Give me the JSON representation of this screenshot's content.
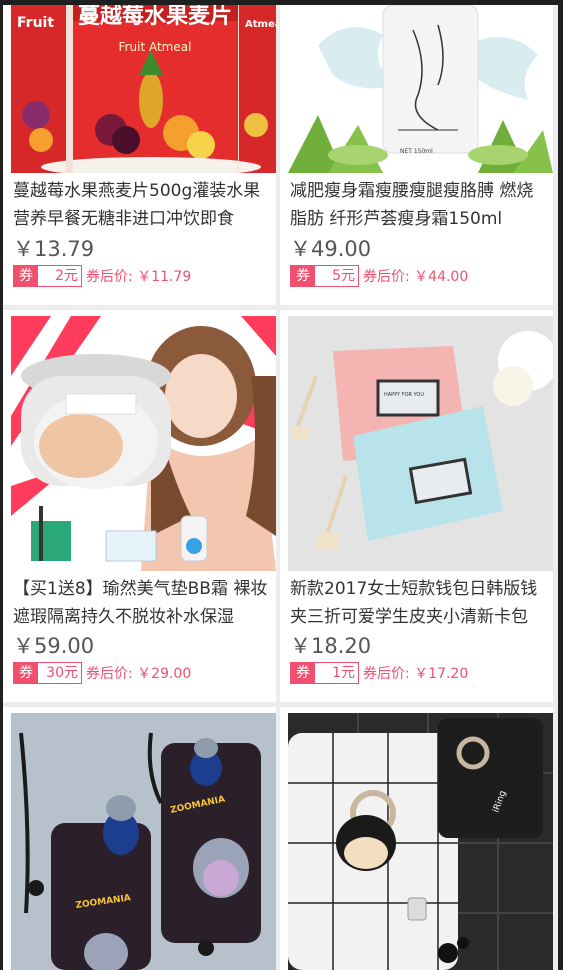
{
  "products": [
    {
      "title": "蔓越莓水果燕麦片500g灌装水果营养早餐无糖非进口冲饮即食",
      "price": "￥13.79",
      "coupon_label": "券",
      "coupon_amount": "2元",
      "after_price": "券后价: ￥11.79",
      "image_alt": "oatmeal-cans-image",
      "image_text_1": "蔓越莓水果麦片",
      "image_text_2": "Fruit Atmeal"
    },
    {
      "title": "减肥瘦身霜瘦腰瘦腿瘦胳膊 燃烧脂肪 纤形芦荟瘦身霜150ml",
      "price": "￥49.00",
      "coupon_label": "券",
      "coupon_amount": "5元",
      "after_price": "券后价: ￥44.00",
      "image_alt": "slimming-cream-tube-image",
      "image_text_1": "NET 150ml"
    },
    {
      "title": "【买1送8】瑜然美气垫BB霜 裸妆遮瑕隔离持久不脱妆补水保湿",
      "price": "￥59.00",
      "coupon_label": "券",
      "coupon_amount": "30元",
      "after_price": "券后价: ￥29.00",
      "image_alt": "cushion-bb-cream-image"
    },
    {
      "title": "新款2017女士短款钱包日韩版钱夹三折可爱学生皮夹小清新卡包",
      "price": "￥18.20",
      "coupon_label": "券",
      "coupon_amount": "1元",
      "after_price": "券后价: ￥17.20",
      "image_alt": "wallets-image",
      "image_text_1": "HAPPY FOR YOU"
    },
    {
      "image_alt": "phone-case-zootopia-image",
      "image_text_1": "ZOOMANIA"
    },
    {
      "image_alt": "phone-case-ring-image",
      "image_text_1": "iRing"
    }
  ]
}
